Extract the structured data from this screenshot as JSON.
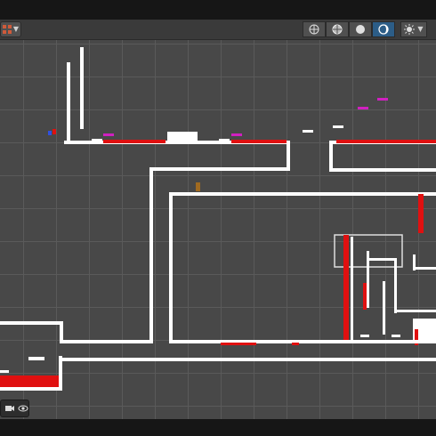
{
  "window": {
    "title": ""
  },
  "toolbar": {
    "grid_snap_icon": "grid-snap-icon",
    "scene_view_buttons": [
      {
        "name": "wireframe-shading-icon",
        "active": false
      },
      {
        "name": "shaded-wireframe-icon",
        "active": false
      },
      {
        "name": "shaded-icon",
        "active": false
      },
      {
        "name": "unlit-shading-icon",
        "active": true
      }
    ],
    "effects_icon": "scene-effects-icon"
  },
  "overlay": {
    "camera_icon": "camera-icon",
    "visibility_icon": "eye-icon"
  },
  "colors": {
    "grid_bg": "#484848",
    "grid_line": "#5a5a5a",
    "wall": "#ffffff",
    "hazard": "#e01010",
    "pickup": "#d020c0",
    "active_button": "#2c5d87"
  }
}
